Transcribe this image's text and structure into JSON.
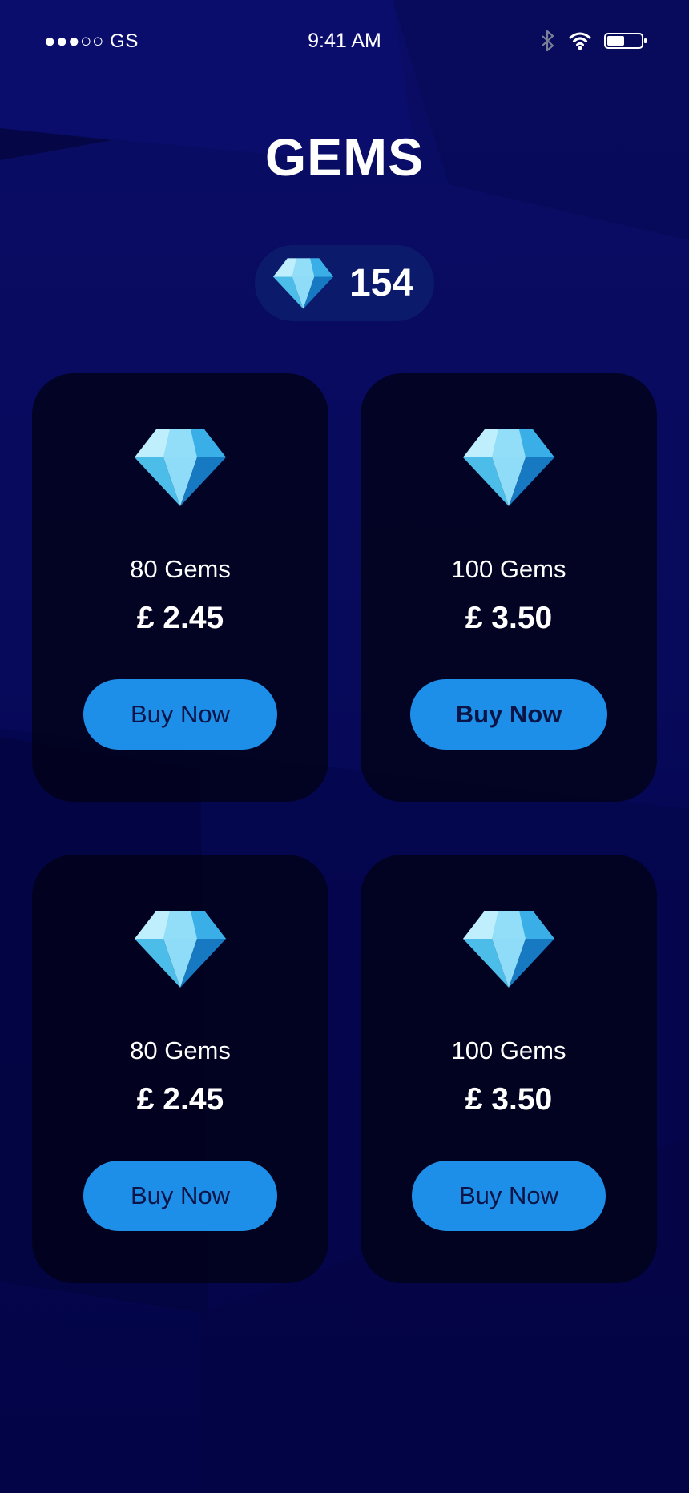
{
  "status_bar": {
    "carrier": "●●●○○ GS",
    "time": "9:41 AM",
    "icons": [
      "bluetooth-icon",
      "wifi-icon",
      "battery-icon"
    ]
  },
  "header": {
    "title": "GEMS"
  },
  "balance": {
    "icon": "gem-icon",
    "count": "154"
  },
  "packages": [
    {
      "name": "80 Gems",
      "price": "£ 2.45",
      "button_label": "Buy Now",
      "icon": "gem-icon"
    },
    {
      "name": "100 Gems",
      "price": "£ 3.50",
      "button_label": "Buy Now",
      "icon": "gem-icon"
    },
    {
      "name": "80 Gems",
      "price": "£ 2.45",
      "button_label": "Buy Now",
      "icon": "gem-icon"
    },
    {
      "name": "100 Gems",
      "price": "£ 3.50",
      "button_label": "Buy Now",
      "icon": "gem-icon"
    }
  ],
  "colors": {
    "background": "#07095a",
    "card": "#02021a",
    "accent": "#1d8fe8",
    "button_text": "#0a1446",
    "text": "#ffffff"
  }
}
